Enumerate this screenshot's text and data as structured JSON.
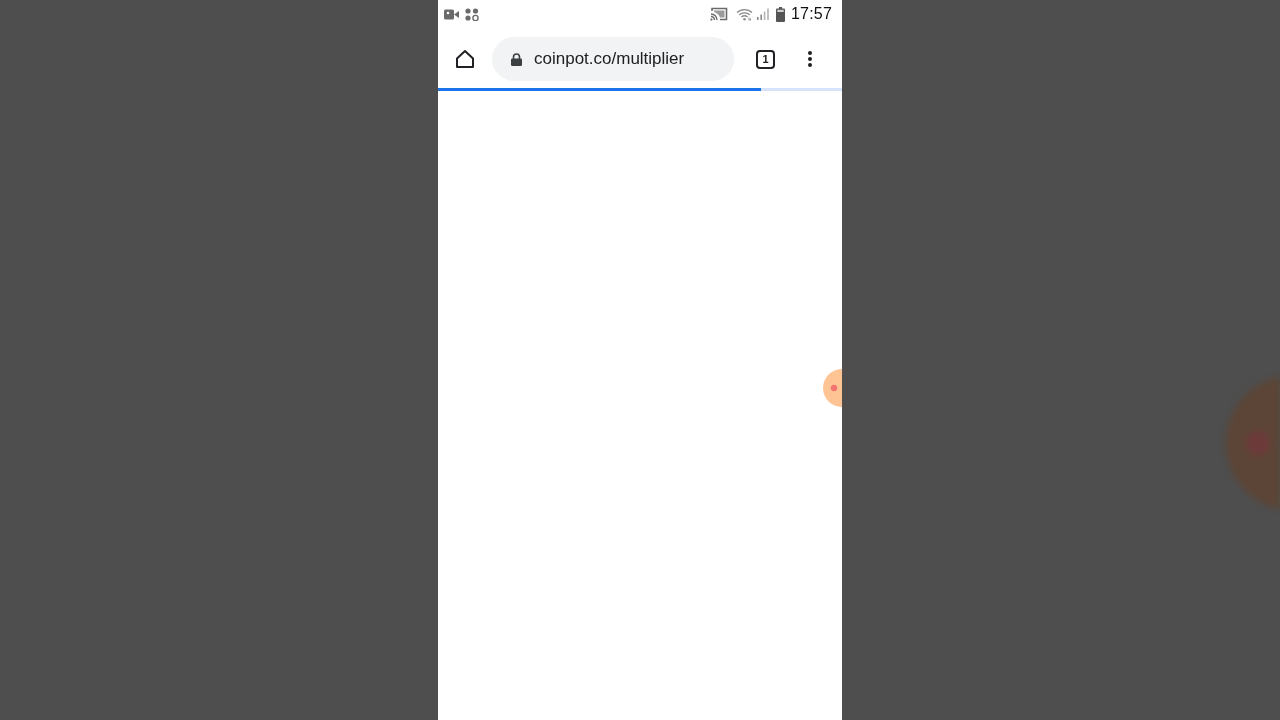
{
  "status_bar": {
    "time": "17:57"
  },
  "browser_bar": {
    "url": "coinpot.co/multiplier",
    "tab_count": "1"
  },
  "page_load": {
    "level": 0.8
  }
}
